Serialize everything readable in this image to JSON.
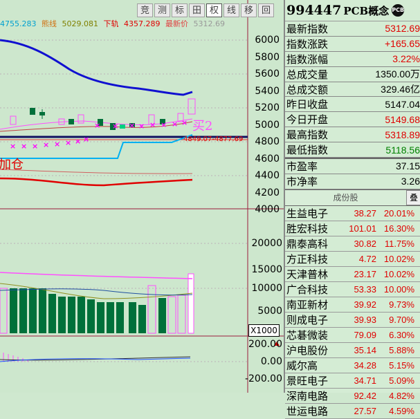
{
  "toolbar": {
    "buttons": [
      "竞",
      "测",
      "标",
      "田",
      "权",
      "线",
      "移",
      "回"
    ],
    "active_index": 4
  },
  "top_info": {
    "value1": "4755.283",
    "label_bear": "熊线",
    "value2": "5029.081",
    "label_lower": "下轨",
    "value3": "4357.289",
    "label_new": "最新价",
    "value4": "5312.69"
  },
  "chart": {
    "price_labels": [
      "6000",
      "5800",
      "5600",
      "5400",
      "5200",
      "5000",
      "4800",
      "4600",
      "4400",
      "4200",
      "4000"
    ],
    "volume_labels": [
      "20000",
      "15000",
      "10000",
      "5000"
    ],
    "volume_unit": "X1000",
    "macd_labels": [
      "200.00",
      "0.00",
      "-200.00"
    ],
    "range_text": "4849.07-4877.69",
    "buy_label": "买2",
    "add_label": "加仓",
    "colors": {
      "ma_blue": "#1010d0",
      "up": "#ff4fff",
      "down": "#00703a",
      "red_line": "#e00000",
      "cyan": "#00b0f0"
    }
  },
  "panel": {
    "code": "994447",
    "name": "PCB概念",
    "logo": "PCB",
    "quotes": [
      {
        "label": "最新指数",
        "value": "5312.69",
        "color": "red"
      },
      {
        "label": "指数涨跌",
        "value": "+165.65",
        "color": "red"
      },
      {
        "label": "指数涨幅",
        "value": "3.22%",
        "color": "red"
      },
      {
        "label": "总成交量",
        "value": "1350.00万",
        "color": "black"
      },
      {
        "label": "总成交额",
        "value": "329.46亿",
        "color": "black"
      },
      {
        "label": "昨日收盘",
        "value": "5147.04",
        "color": "black"
      },
      {
        "label": "今日开盘",
        "value": "5149.68",
        "color": "red"
      },
      {
        "label": "最高指数",
        "value": "5318.89",
        "color": "red"
      },
      {
        "label": "最低指数",
        "value": "5118.56",
        "color": "green"
      }
    ],
    "ratios": [
      {
        "label": "市盈率",
        "value": "37.15"
      },
      {
        "label": "市净率",
        "value": "3.26"
      }
    ],
    "components_header": "成份股",
    "components_button": "叠",
    "components": [
      {
        "name": "生益电子",
        "price": "38.27",
        "change": "20.01%"
      },
      {
        "name": "胜宏科技",
        "price": "101.01",
        "change": "16.30%"
      },
      {
        "name": "鼎泰高科",
        "price": "30.82",
        "change": "11.75%"
      },
      {
        "name": "方正科技",
        "price": "4.72",
        "change": "10.02%"
      },
      {
        "name": "天津普林",
        "price": "23.17",
        "change": "10.02%"
      },
      {
        "name": "广合科技",
        "price": "53.33",
        "change": "10.00%"
      },
      {
        "name": "南亚新材",
        "price": "39.92",
        "change": "9.73%"
      },
      {
        "name": "则成电子",
        "price": "39.93",
        "change": "9.70%"
      },
      {
        "name": "芯碁微装",
        "price": "79.09",
        "change": "6.30%"
      },
      {
        "name": "沪电股份",
        "price": "35.14",
        "change": "5.88%"
      },
      {
        "name": "威尔高",
        "price": "34.28",
        "change": "5.15%"
      },
      {
        "name": "景旺电子",
        "price": "34.71",
        "change": "5.09%"
      },
      {
        "name": "深南电路",
        "price": "92.42",
        "change": "4.82%"
      },
      {
        "name": "世运电路",
        "price": "27.57",
        "change": "4.59%"
      }
    ]
  }
}
